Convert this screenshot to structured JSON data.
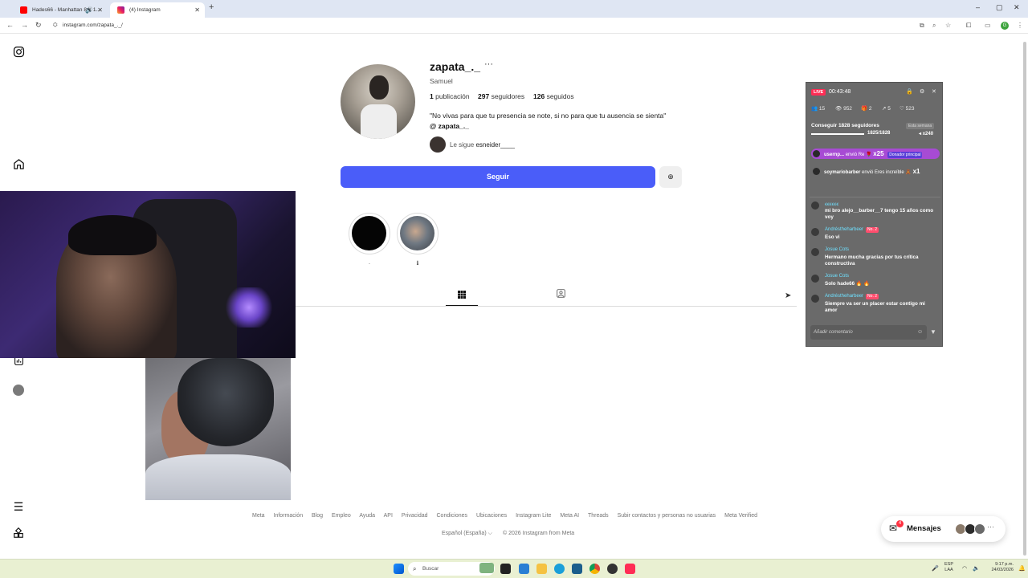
{
  "browser": {
    "tabs": [
      {
        "title": "Hades66 - Manhattan 8 X 1..."
      },
      {
        "title": "(4) Instagram"
      }
    ],
    "url": "instagram.com/zapata_._/"
  },
  "profile": {
    "username": "zapata_._",
    "full_name": "Samuel",
    "posts_count": "1",
    "posts_label": "publicación",
    "followers_count": "297",
    "followers_label": "seguidores",
    "following_count": "126",
    "following_label": "seguidos",
    "bio": "\"No vivas para que tu presencia se note, si no para que tu ausencia se sienta\"",
    "threads_handle": "zapata_._",
    "followed_by_prefix": "Le sigue",
    "followed_by_user": "esneider____",
    "follow_button": "Seguir",
    "highlights": [
      {
        "label": "."
      },
      {
        "label": "ℹ"
      }
    ]
  },
  "live": {
    "badge": "LIVE",
    "time": "00:43:48",
    "stats": [
      "15",
      "952",
      "2",
      "5",
      "523"
    ],
    "goal_title": "Conseguir 1828 seguidores",
    "goal_tag": "Esta semana",
    "goal_count": "1825/1828",
    "goal_fraction": 0.998,
    "goal_plus": "x240",
    "gifts": [
      {
        "user": "usernp...",
        "text": "envió Re",
        "mult": "x25",
        "tag": "Donador principal"
      },
      {
        "user": "soymariobarber",
        "text": "envió Eres increíble",
        "mult": "x1"
      }
    ],
    "comments": [
      {
        "user": "ꞓꞓꞓꞓꞓꞓ",
        "badge": "",
        "text": "mi bro alejo__barber__7 tengo 15 años como voy"
      },
      {
        "user": "Andréstheharbeer",
        "badge": "No. 2",
        "text": "Eso vi"
      },
      {
        "user": "Josue Cots",
        "badge": "",
        "text": "Hermano mucha gracias por tus crítica constructiva"
      },
      {
        "user": "Josue Cots",
        "badge": "",
        "text": "Solo hade66 🔥 🔥"
      },
      {
        "user": "Andréstheharbeer",
        "badge": "No. 2",
        "text": "Siempre va ser un placer estar contigo mi amor"
      }
    ],
    "comment_placeholder": "Añadir comentario"
  },
  "footer": {
    "links": [
      "Meta",
      "Información",
      "Blog",
      "Empleo",
      "Ayuda",
      "API",
      "Privacidad",
      "Condiciones",
      "Ubicaciones",
      "Instagram Lite",
      "Meta AI",
      "Threads",
      "Subir contactos y personas no usuarias",
      "Meta Verified"
    ],
    "language": "Español (España) ⌵",
    "copyright": "© 2026 Instagram from Meta"
  },
  "messages": {
    "label": "Mensajes",
    "badge": "4"
  },
  "taskbar": {
    "search_placeholder": "Buscar",
    "lang_line1": "ESP",
    "lang_line2": "LAA",
    "time": "9:17 p.m.",
    "date": "24/03/2026"
  },
  "icons": {
    "instagram": "instagram-icon",
    "home": "home-icon",
    "menu": "menu-icon",
    "grid": "grid-icon",
    "tagged": "tagged-icon"
  },
  "colors": {
    "follow_button": "#4a5df9",
    "live_badge": "#ff2d55",
    "gift_highlight": "#a74bd4",
    "taskbar": "#e9f0d2"
  }
}
